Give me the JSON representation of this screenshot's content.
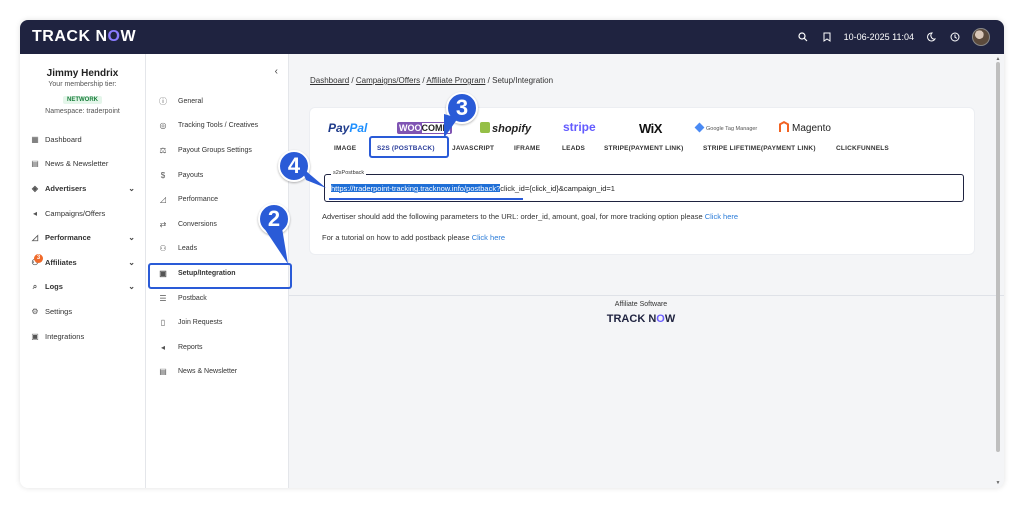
{
  "topbar": {
    "logo_track": "TRACK N",
    "logo_o": "O",
    "logo_w": "W",
    "datetime": "10-06-2025 11:04",
    "icons": [
      "search-icon",
      "bookmark-icon",
      "moon-icon",
      "clock-icon",
      "avatar"
    ]
  },
  "user": {
    "name": "Jimmy Hendrix",
    "tier_label": "Your membership tier:",
    "tier": "NETWORK",
    "namespace": "Namespace: traderpoint"
  },
  "nav": {
    "items": [
      {
        "label": "Dashboard",
        "icon": "grid-icon"
      },
      {
        "label": "News & Newsletter",
        "icon": "news-icon"
      },
      {
        "label": "Advertisers",
        "icon": "tag-icon"
      },
      {
        "label": "Campaigns/Offers",
        "icon": "megaphone-icon"
      },
      {
        "label": "Performance",
        "icon": "chart-icon"
      },
      {
        "label": "Affiliates",
        "icon": "people-icon",
        "badge": "3"
      },
      {
        "label": "Logs",
        "icon": "search-icon"
      },
      {
        "label": "Settings",
        "icon": "gear-icon"
      },
      {
        "label": "Integrations",
        "icon": "puzzle-icon"
      }
    ]
  },
  "submenu": {
    "items": [
      {
        "label": "General",
        "icon": "info-icon"
      },
      {
        "label": "Tracking Tools / Creatives",
        "icon": "target-icon"
      },
      {
        "label": "Payout Groups Settings",
        "icon": "payout-icon"
      },
      {
        "label": "Payouts",
        "icon": "money-icon"
      },
      {
        "label": "Performance",
        "icon": "chart-icon"
      },
      {
        "label": "Conversions",
        "icon": "conversion-icon"
      },
      {
        "label": "Leads",
        "icon": "lead-icon"
      },
      {
        "label": "Setup/Integration",
        "icon": "setup-icon"
      },
      {
        "label": "Postback",
        "icon": "postback-icon"
      },
      {
        "label": "Join Requests",
        "icon": "document-icon"
      },
      {
        "label": "Reports",
        "icon": "report-icon"
      },
      {
        "label": "News & Newsletter",
        "icon": "news-icon"
      }
    ]
  },
  "breadcrumb": {
    "items": [
      "Dashboard",
      "Campaigns/Offers",
      "Affiliate Program",
      "Setup/Integration"
    ],
    "sep": "/"
  },
  "brands": {
    "paypal_a": "Pay",
    "paypal_b": "Pal",
    "woo": "WOO",
    "comm": "COMM",
    "shopify": "shopify",
    "stripe": "stripe",
    "wix": "WiX",
    "gtm": "Google Tag Manager",
    "magento": "Magento"
  },
  "tabs": [
    "IMAGE",
    "S2S (POSTBACK)",
    "JAVASCRIPT",
    "IFRAME",
    "LEADS",
    "STRIPE(PAYMENT LINK)",
    "STRIPE LIFETIME(PAYMENT LINK)",
    "CLICKFUNNELS"
  ],
  "postback": {
    "legend": "s2sPostback",
    "url_selected": "https://traderpoint-tracking.tracknow.info/postback?",
    "url_rest": "click_id={click_id}&campaign_id=1"
  },
  "notes": {
    "note1_text": "Advertiser should add the following parameters to the URL: order_id, amount, goal, for more tracking option please ",
    "note1_link": "Click here",
    "note2_text": "For a tutorial on how to add postback please ",
    "note2_link": "Click here"
  },
  "footer": {
    "caption": "Affiliate Software",
    "logo_a": "TRACK N",
    "logo_o": "O",
    "logo_w": "W"
  },
  "callouts": [
    "2",
    "3",
    "4"
  ],
  "colors": {
    "topbar": "#1f2340",
    "accent": "#2a5bd7",
    "link": "#2a7bd8"
  }
}
